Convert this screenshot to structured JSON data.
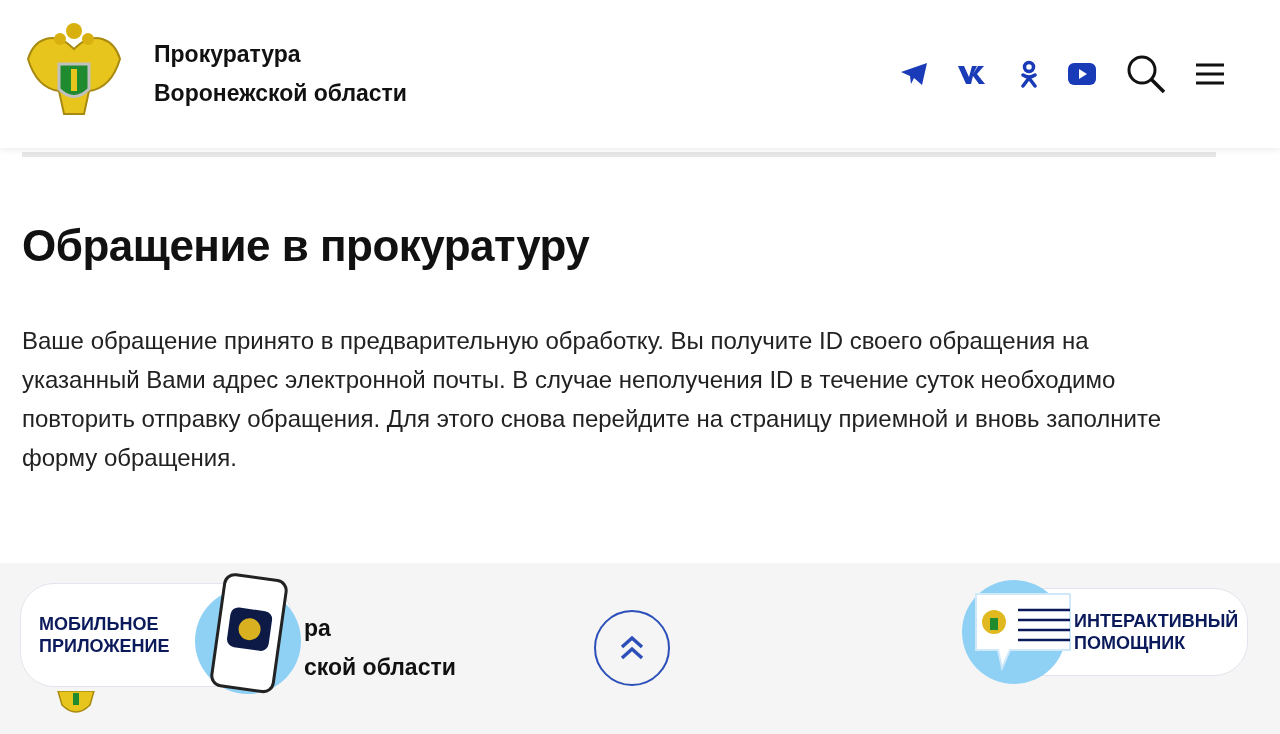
{
  "header": {
    "org_line_1": "Прокуратура",
    "org_line_2": "Воронежской области"
  },
  "page": {
    "title": "Обращение в прокуратуру",
    "message": "Ваше обращение принято в предварительную обработку. Вы получите ID своего обращения на указанный Вами адрес электронной почты. В случае неполучения ID в течение суток необходимо повторить отправку обращения. Для этого снова перейдите на страницу приемной и вновь заполните форму обращения."
  },
  "footer": {
    "org_fragment_1": "ра",
    "org_fragment_2": "ской области"
  },
  "widgets": {
    "mobile_app": {
      "line_1": "МОБИЛЬНОЕ",
      "line_2": "ПРИЛОЖЕНИЕ"
    },
    "assistant": {
      "line_1": "ИНТЕРАКТИВНЫЙ",
      "line_2": "ПОМОЩНИК"
    }
  }
}
